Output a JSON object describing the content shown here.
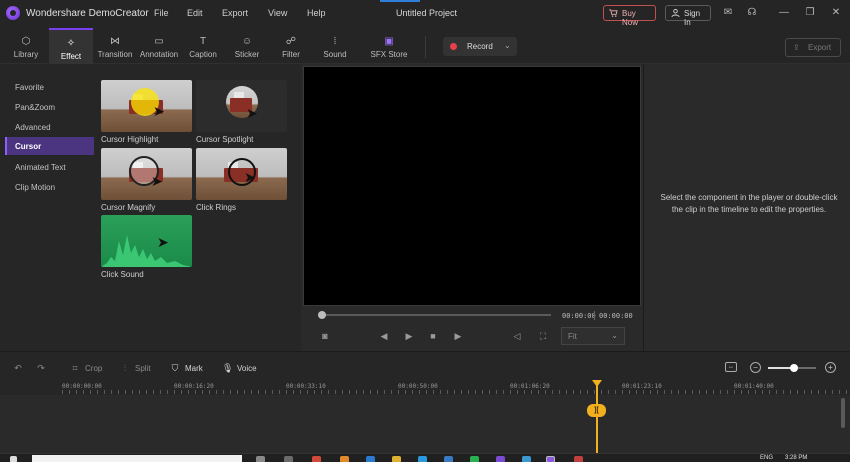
{
  "app": {
    "name": "Wondershare DemoCreator",
    "project_title": "Untitled Project",
    "menu": [
      "File",
      "Edit",
      "Export",
      "View",
      "Help"
    ],
    "buy_label": "Buy Now",
    "sign_in_label": "Sign In"
  },
  "tabs": [
    {
      "label": "Library",
      "icon": "library-icon"
    },
    {
      "label": "Effect",
      "icon": "effect-wand-icon",
      "active": true
    },
    {
      "label": "Transition",
      "icon": "transition-icon"
    },
    {
      "label": "Annotation",
      "icon": "annotation-icon"
    },
    {
      "label": "Caption",
      "icon": "caption-icon"
    },
    {
      "label": "Sticker",
      "icon": "sticker-icon"
    },
    {
      "label": "Filter",
      "icon": "filter-icon"
    },
    {
      "label": "Sound",
      "icon": "sound-wave-icon"
    },
    {
      "label": "SFX Store",
      "icon": "sfx-store-icon"
    }
  ],
  "record_label": "Record",
  "export_label": "Export",
  "categories": [
    {
      "label": "Favorite"
    },
    {
      "label": "Pan&Zoom"
    },
    {
      "label": "Advanced"
    },
    {
      "label": "Cursor",
      "active": true
    },
    {
      "label": "Animated Text"
    },
    {
      "label": "Clip Motion"
    }
  ],
  "effects": [
    {
      "label": "Cursor Highlight"
    },
    {
      "label": "Cursor Spotlight"
    },
    {
      "label": "Cursor Magnify"
    },
    {
      "label": "Click Rings"
    },
    {
      "label": "Click Sound"
    }
  ],
  "player": {
    "current_time": "00:00:00",
    "total_time": "00:00:00",
    "fit_label": "Fit"
  },
  "properties_message": "Select the component in the player or double-click the clip in the timeline to edit the properties.",
  "timeline_tools": {
    "crop": "Crop",
    "split": "Split",
    "mark": "Mark",
    "voice": "Voice"
  },
  "ruler_labels": [
    "00:00:00:00",
    "00:00:16:20",
    "00:00:33:10",
    "00:00:50:00",
    "00:01:06:20",
    "00:01:23:10",
    "00:01:40:00"
  ],
  "taskbar": {
    "lang": "ENG",
    "time": "3:28 PM"
  },
  "colors": {
    "accent": "#7a3ff0",
    "record": "#e8404a",
    "playhead": "#f2b01e"
  }
}
